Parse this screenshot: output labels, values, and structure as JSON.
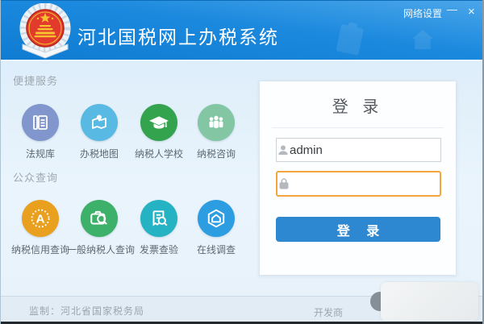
{
  "window": {
    "title": "河北国税网上办税系统",
    "network_settings_label": "网络设置",
    "minimize_glyph": "—",
    "close_glyph": "×"
  },
  "sidebar": {
    "sections": [
      {
        "label": "便捷服务",
        "items": [
          {
            "label": "法规库",
            "icon": "book-icon",
            "color": "#8096cd"
          },
          {
            "label": "办税地图",
            "icon": "map-pin-icon",
            "color": "#58b9e3"
          },
          {
            "label": "纳税人学校",
            "icon": "graduation-cap-icon",
            "color": "#33a34d"
          },
          {
            "label": "纳税咨询",
            "icon": "people-icon",
            "color": "#82c6a4"
          }
        ]
      },
      {
        "label": "公众查询",
        "items": [
          {
            "label": "纳税信用查询",
            "icon": "credit-a-icon",
            "color": "#e9a01f"
          },
          {
            "label": "一般纳税人查询",
            "icon": "camera-search-icon",
            "color": "#3db069"
          },
          {
            "label": "发票查验",
            "icon": "invoice-search-icon",
            "color": "#25b2c3"
          },
          {
            "label": "在线调查",
            "icon": "hexagon-survey-icon",
            "color": "#2d9de2"
          }
        ]
      }
    ]
  },
  "login": {
    "title": "登 录",
    "username_value": "admin",
    "password_value": "",
    "submit_label": "登  录",
    "accent_color": "#2d87d1",
    "focus_border_color": "#f3a53c"
  },
  "footer": {
    "supervisor": "监制：河北省国家税务局",
    "developer_label": "开发商"
  }
}
